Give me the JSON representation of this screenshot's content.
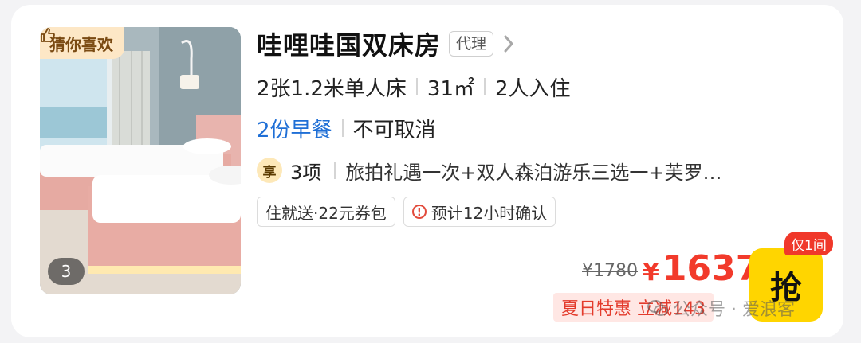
{
  "listing": {
    "tag": "猜你喜欢",
    "photo_count": "3",
    "title": "哇哩哇国双床房",
    "agent_badge": "代理",
    "beds": "2张1.2米单人床",
    "area": "31㎡",
    "occupancy": "2人入住",
    "breakfast": "2份早餐",
    "cancellation": "不可取消",
    "perk_icon": "享",
    "perk_count": "3项",
    "perk_text": "旅拍礼遇一次+双人森泊游乐三选一+芙罗…",
    "chips": [
      "住就送·22元券包",
      "预计12小时确认"
    ],
    "original_price": "¥1780",
    "currency": "¥",
    "price": "1637",
    "promo": "夏日特惠 立减143",
    "grab_label": "抢",
    "stock_badge": "仅1间",
    "watermark": "公众号 · 爱浪客"
  },
  "colors": {
    "price_red": "#f23a2b",
    "meal_blue": "#1f6fd6",
    "grab_yellow": "#ffd500",
    "tag_bg": "#fde7c6"
  },
  "icons": {
    "tag": "thumbs-up-icon",
    "title": "chevron-right-icon",
    "chip_confirm": "alert-circle-icon",
    "watermark": "wechat-icon"
  }
}
